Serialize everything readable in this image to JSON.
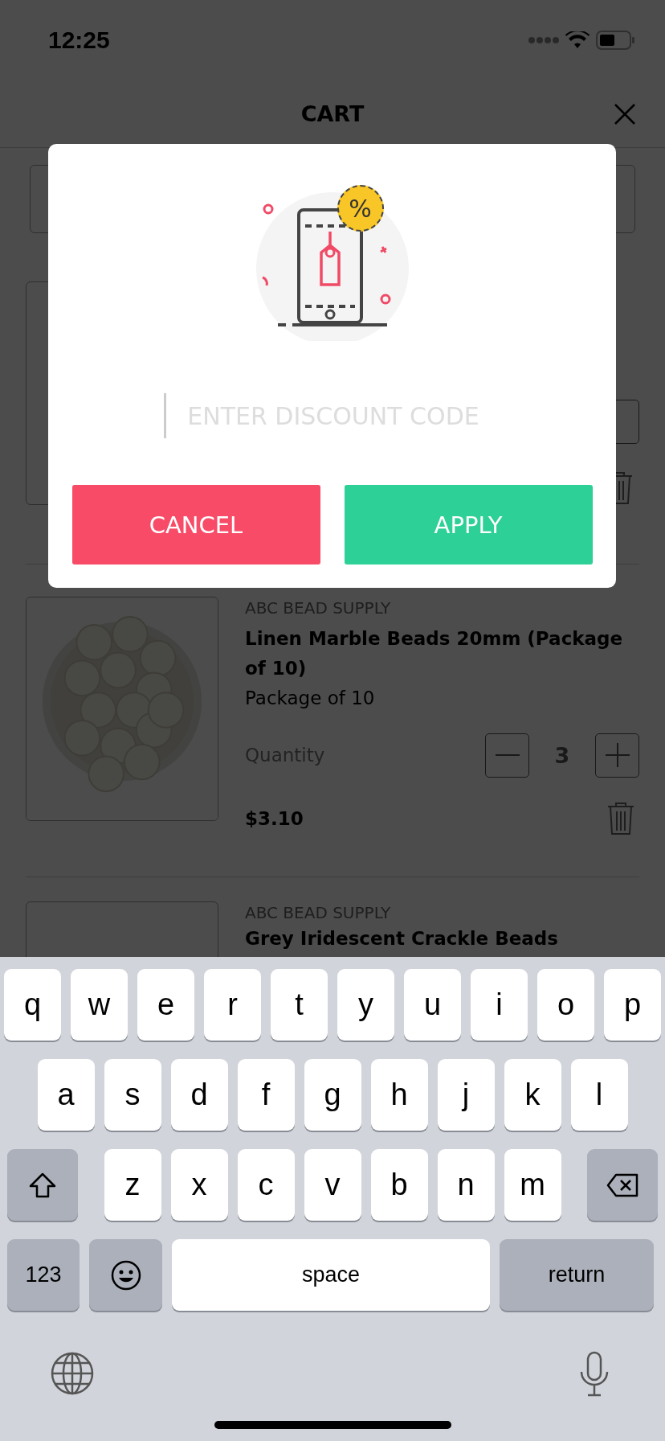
{
  "status_bar": {
    "time": "12:25"
  },
  "header": {
    "title": "CART"
  },
  "cart_items": [
    {
      "seller": "ABC BEAD SUPPLY",
      "name": "Linen Marble Beads 20mm (Package of 10)",
      "variant": "Package of 10",
      "quantity_label": "Quantity",
      "quantity": "3",
      "price": "$3.10"
    },
    {
      "seller": "ABC BEAD SUPPLY",
      "name": "Grey Iridescent Crackle Beads"
    }
  ],
  "dialog": {
    "badge": "%",
    "placeholder": "ENTER DISCOUNT CODE",
    "buttons": [
      {
        "label": "CANCEL",
        "kind": "cancel"
      },
      {
        "label": "APPLY",
        "kind": "apply"
      }
    ]
  },
  "keyboard": {
    "rows": [
      [
        "q",
        "w",
        "e",
        "r",
        "t",
        "y",
        "u",
        "i",
        "o",
        "p"
      ],
      [
        "a",
        "s",
        "d",
        "f",
        "g",
        "h",
        "j",
        "k",
        "l"
      ],
      [
        "z",
        "x",
        "c",
        "v",
        "b",
        "n",
        "m"
      ]
    ],
    "numbers_key": "123",
    "space_key": "space",
    "return_key": "return"
  }
}
